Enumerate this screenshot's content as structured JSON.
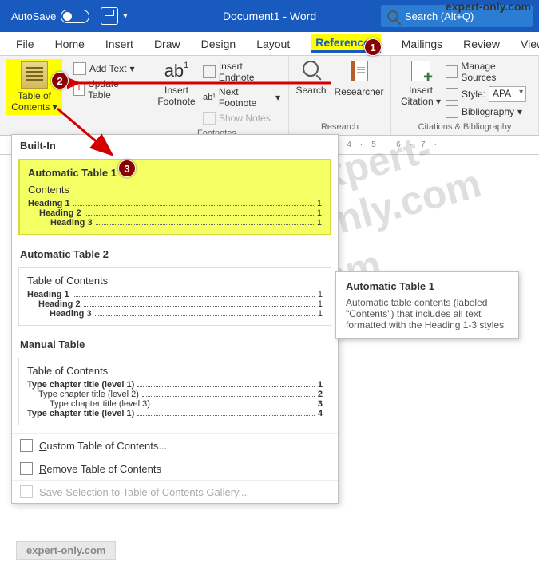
{
  "watermark_top": "expert-only.com",
  "watermark_big": "expert-only.com",
  "watermark_bottom": "expert-only.com",
  "titlebar": {
    "autosave": "AutoSave",
    "toggle_state": "Off",
    "doc_title": "Document1  -  Word",
    "search_placeholder": "Search (Alt+Q)"
  },
  "tabs": [
    "File",
    "Home",
    "Insert",
    "Draw",
    "Design",
    "Layout",
    "References",
    "Mailings",
    "Review",
    "View"
  ],
  "active_tab_index": 6,
  "ribbon": {
    "toc": {
      "label_line1": "Table of",
      "label_line2": "Contents"
    },
    "addtext": "Add Text",
    "update": "Update Table",
    "footnote": {
      "big": "Insert Footnote",
      "end": "Insert Endnote",
      "next": "Next Footnote",
      "show": "Show Notes",
      "group": "Footnotes"
    },
    "search": "Search",
    "researcher": "Researcher",
    "research_group": "Research",
    "citation": {
      "big_line1": "Insert",
      "big_line2": "Citation",
      "manage": "Manage Sources",
      "style_lab": "Style:",
      "style_val": "APA",
      "biblio": "Bibliography",
      "group": "Citations & Bibliography"
    }
  },
  "ruler_marks": [
    "4",
    "5",
    "6",
    "7"
  ],
  "gallery": {
    "builtin": "Built-In",
    "auto1": {
      "title": "Automatic Table 1",
      "contents_label": "Contents",
      "rows": [
        {
          "t": "Heading 1",
          "p": "1"
        },
        {
          "t": "Heading 2",
          "p": "1"
        },
        {
          "t": "Heading 3",
          "p": "1"
        }
      ]
    },
    "auto2": {
      "title": "Automatic Table 2",
      "contents_label": "Table of Contents",
      "rows": [
        {
          "t": "Heading 1",
          "p": "1"
        },
        {
          "t": "Heading 2",
          "p": "1"
        },
        {
          "t": "Heading 3",
          "p": "1"
        }
      ]
    },
    "manual": {
      "title": "Manual Table",
      "contents_label": "Table of Contents",
      "rows": [
        {
          "t": "Type chapter title (level 1)",
          "p": "1"
        },
        {
          "t": "Type chapter title (level 2)",
          "p": "2"
        },
        {
          "t": "Type chapter title (level 3)",
          "p": "3"
        },
        {
          "t": "Type chapter title (level 1)",
          "p": "4"
        }
      ]
    },
    "custom": "Custom Table of Contents...",
    "remove": "Remove Table of Contents",
    "save_sel": "Save Selection to Table of Contents Gallery...",
    "custom_key": "C",
    "remove_key": "R",
    "save_key": "S"
  },
  "tooltip": {
    "title": "Automatic Table 1",
    "body": "Automatic table contents (labeled \"Contents\") that includes all text formatted with the Heading 1-3 styles"
  },
  "callouts": [
    "1",
    "2",
    "3"
  ]
}
